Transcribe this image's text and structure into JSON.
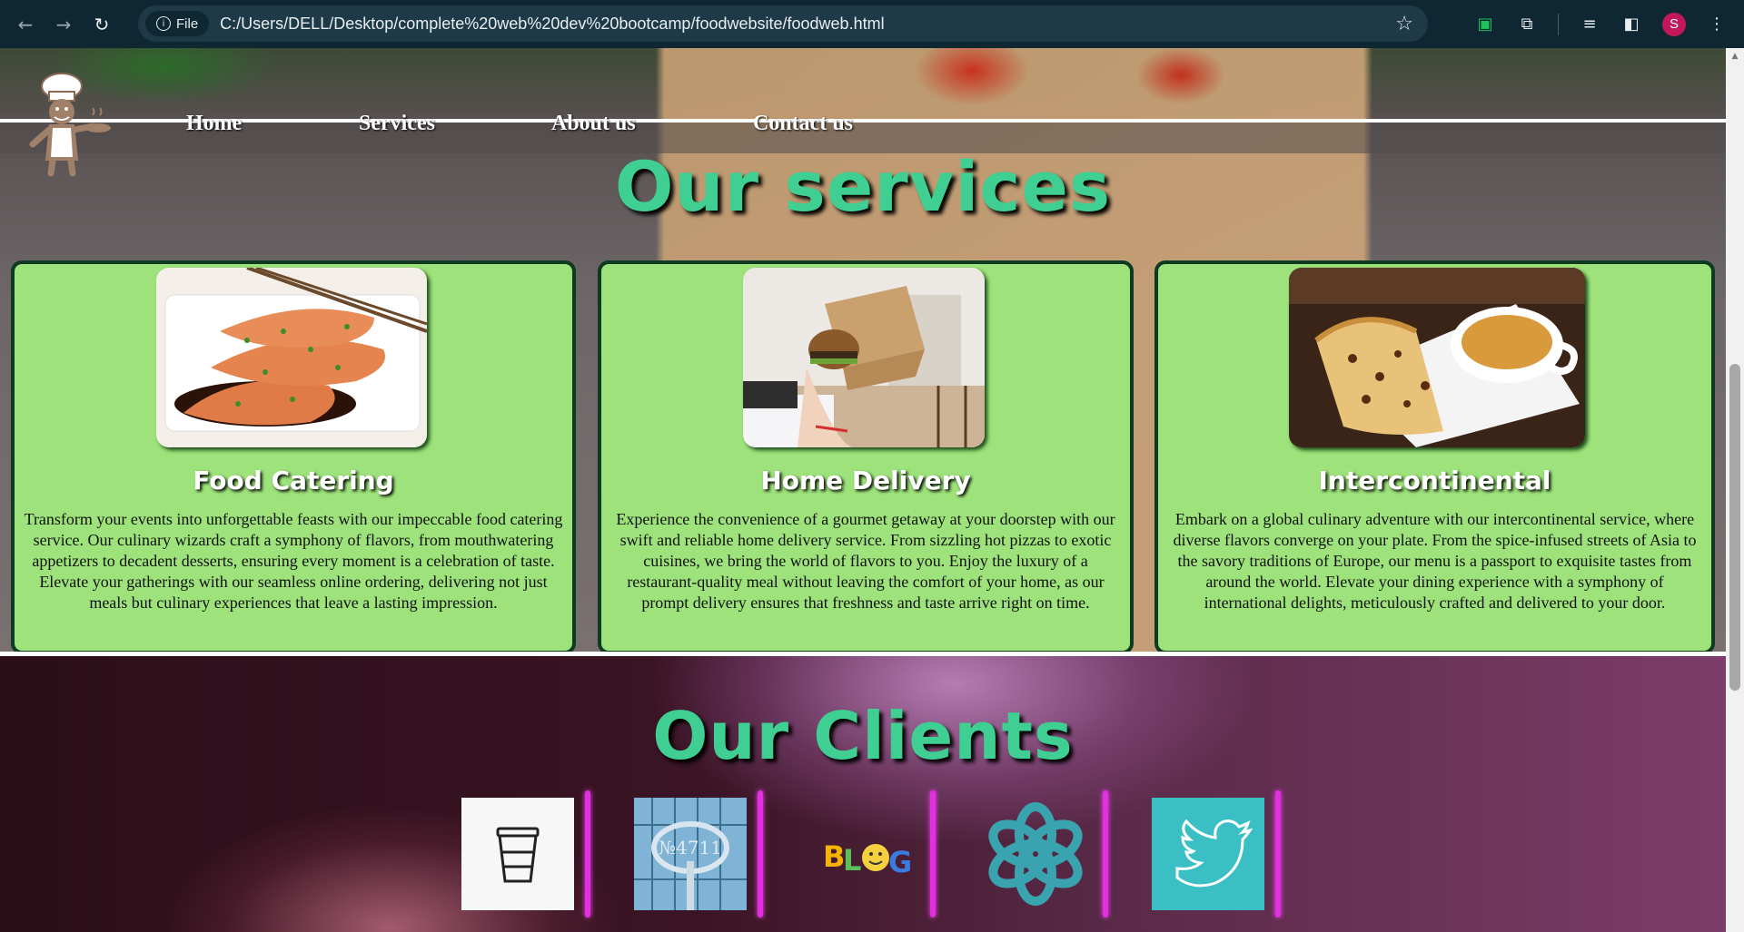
{
  "browser": {
    "file_chip": "File",
    "url": "C:/Users/DELL/Desktop/complete%20web%20dev%20bootcamp/foodwebsite/foodweb.html",
    "profile_initial": "S",
    "icons": [
      "back-icon",
      "forward-icon",
      "reload-icon",
      "info-icon",
      "star-icon",
      "media-icon",
      "extensions-icon",
      "tab-search-icon",
      "side-panel-icon",
      "menu-icon"
    ]
  },
  "nav": {
    "items": [
      "Home",
      "Services",
      "About us",
      "Contact us"
    ]
  },
  "services": {
    "heading": "Our services",
    "cards": [
      {
        "title": "Food Catering",
        "text": "Transform your events into unforgettable feasts with our impeccable food catering service. Our culinary wizards craft a symphony of flavors, from mouthwatering appetizers to decadent desserts, ensuring every moment is a celebration of taste. Elevate your gatherings with our seamless online ordering, delivering not just meals but culinary experiences that leave a lasting impression."
      },
      {
        "title": "Home Delivery",
        "text": "Experience the convenience of a gourmet getaway at your doorstep with our swift and reliable home delivery service. From sizzling hot pizzas to exotic cuisines, we bring the world of flavors to you. Enjoy the luxury of a restaurant-quality meal without leaving the comfort of your home, as our prompt delivery ensures that freshness and taste arrive right on time."
      },
      {
        "title": "Intercontinental",
        "text": "Embark on a global culinary adventure with our intercontinental service, where diverse flavors converge on your plate. From the spice-infused streets of Asia to the savory traditions of Europe, our menu is a passport to exquisite tastes from around the world. Elevate your dining experience with a symphony of international delights, meticulously crafted and delivered to your door."
      }
    ]
  },
  "clients": {
    "heading": "Our Clients",
    "logos": [
      "coffee-cup-logo",
      "signage-logo",
      "blog-logo",
      "knot-logo",
      "twitter-bird-logo"
    ],
    "blog_text": "BLOG"
  },
  "colors": {
    "heading": "#3fcf92",
    "card_bg": "#9de27a",
    "card_border": "#0d3a20",
    "client_accent": "#e22fe2"
  }
}
